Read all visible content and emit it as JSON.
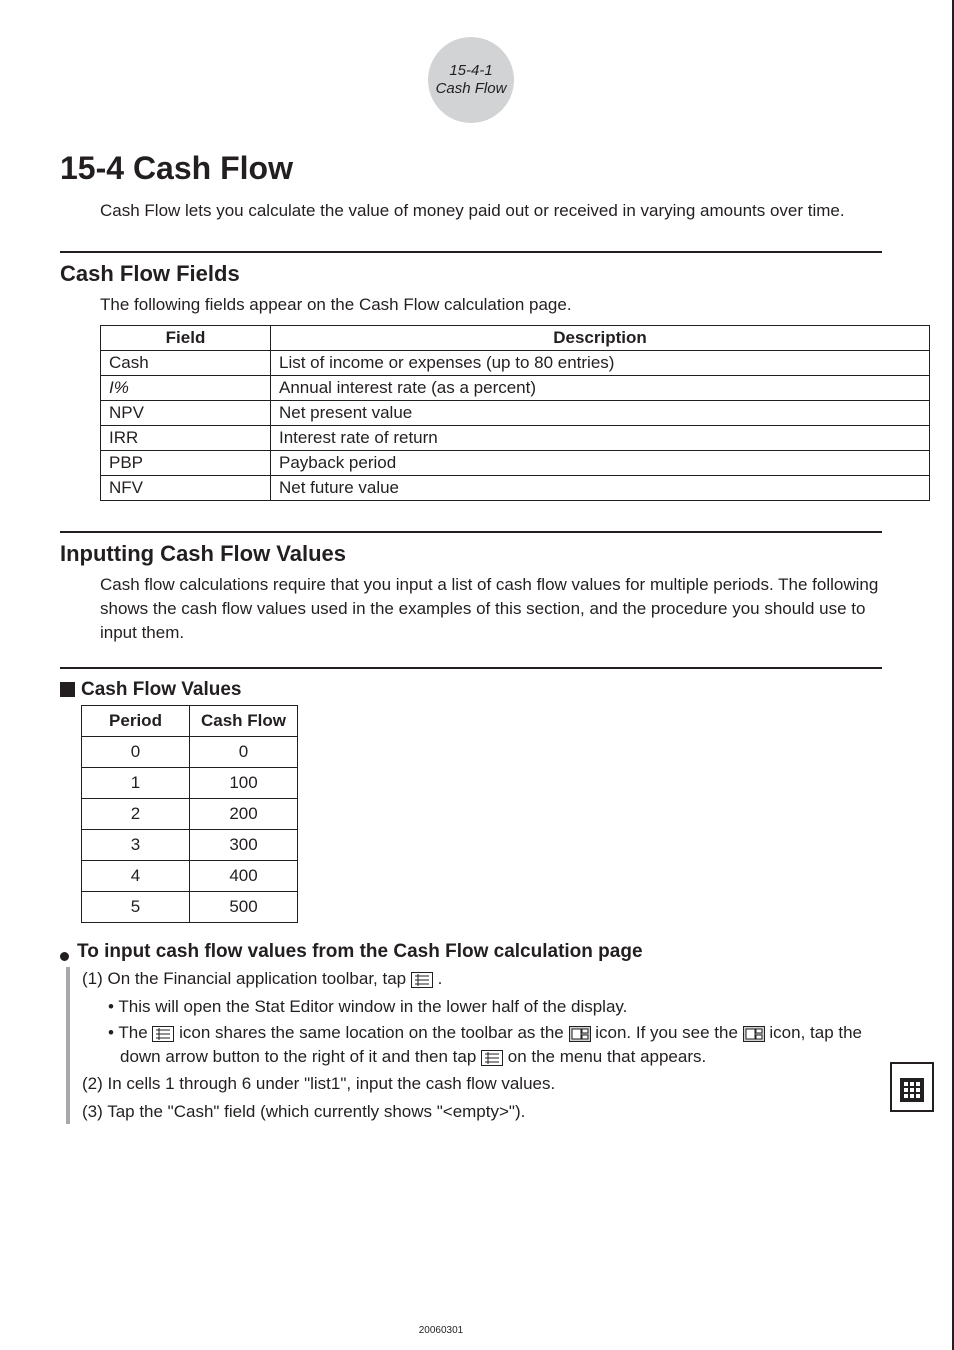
{
  "header": {
    "line1": "15-4-1",
    "line2": "Cash Flow"
  },
  "title": "15-4  Cash Flow",
  "intro": "Cash Flow lets you calculate the value of money paid out or received in varying amounts over time.",
  "section_fields": {
    "heading": "Cash Flow Fields",
    "lead": "The following fields appear on the Cash Flow calculation page.",
    "th_field": "Field",
    "th_desc": "Description",
    "rows": [
      {
        "f": "Cash",
        "d": "List of income or expenses (up to 80 entries)"
      },
      {
        "f": "I%",
        "d": "Annual interest rate (as a percent)"
      },
      {
        "f": "NPV",
        "d": "Net present value"
      },
      {
        "f": "IRR",
        "d": "Interest rate of return"
      },
      {
        "f": "PBP",
        "d": "Payback period"
      },
      {
        "f": "NFV",
        "d": "Net future value"
      }
    ]
  },
  "section_input": {
    "heading": "Inputting Cash Flow Values",
    "lead": "Cash flow calculations require that you input a list of cash flow values for multiple periods. The following shows the cash flow values used in the examples of this section, and the procedure you should use to input them."
  },
  "cfv": {
    "heading": "Cash Flow Values",
    "th_period": "Period",
    "th_cf": "Cash Flow",
    "rows": [
      {
        "p": "0",
        "c": "0"
      },
      {
        "p": "1",
        "c": "100"
      },
      {
        "p": "2",
        "c": "200"
      },
      {
        "p": "3",
        "c": "300"
      },
      {
        "p": "4",
        "c": "400"
      },
      {
        "p": "5",
        "c": "500"
      }
    ]
  },
  "howto": {
    "heading": "To input cash flow values from the Cash Flow calculation page",
    "step1_a": "(1) On the Financial application toolbar, tap ",
    "step1_b": ".",
    "sub1": "This will open the Stat Editor window in the lower half of the display.",
    "sub2_a": "The ",
    "sub2_b": " icon shares the same location on the toolbar as the ",
    "sub2_c": " icon. If you see the ",
    "sub2_d": " icon, tap the down arrow button to the right of it and then tap ",
    "sub2_e": " on the menu that appears.",
    "step2": "(2) In cells 1 through 6 under \"list1\", input the cash flow values.",
    "step3": "(3) Tap the \"Cash\" field (which currently shows \"<empty>\")."
  },
  "footer_date": "20060301",
  "icons": {
    "list": "list-icon",
    "calc": "calc-icon"
  }
}
